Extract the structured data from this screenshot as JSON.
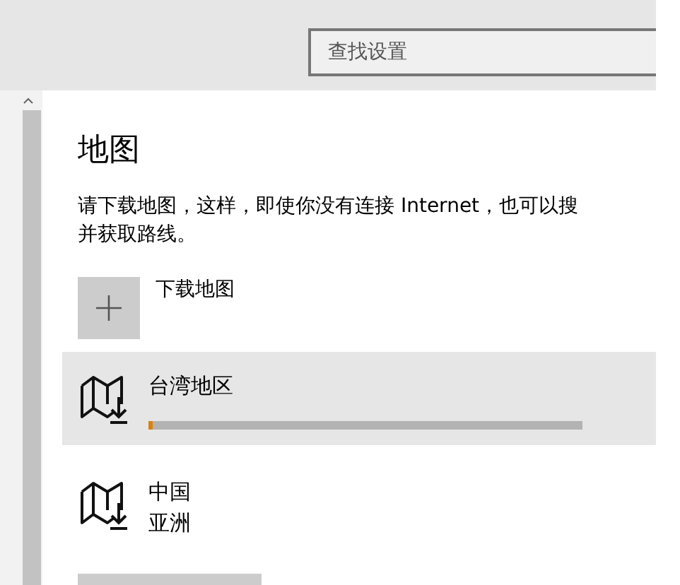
{
  "search": {
    "placeholder": "查找设置"
  },
  "page_title": "地图",
  "description_lines": [
    "请下载地图，这样，即使你没有连接 Internet，也可以搜",
    "并获取路线。"
  ],
  "download_button": {
    "label": "下载地图"
  },
  "maps": [
    {
      "name": "台湾地区",
      "kind": "downloading",
      "selected": true,
      "level": 0.01
    },
    {
      "name": "中国",
      "region": "亚洲",
      "kind": "installed",
      "selected": false
    }
  ]
}
